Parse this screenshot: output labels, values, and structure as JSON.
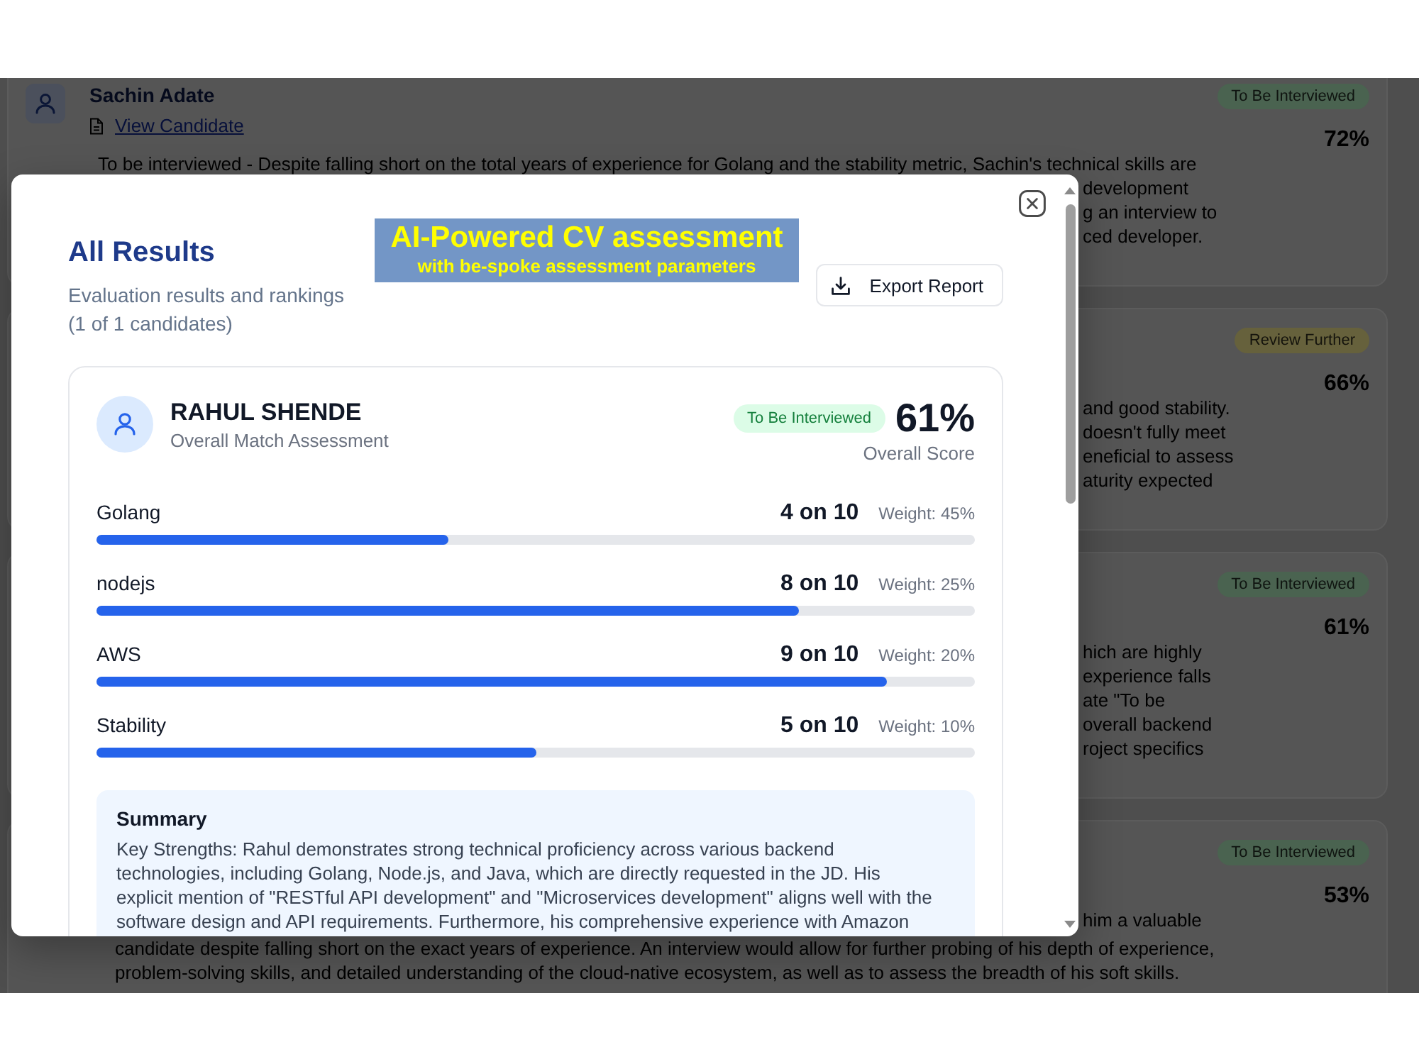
{
  "results_list": {
    "candidates": [
      {
        "name": "Sachin Adate",
        "link": "View Candidate",
        "status": {
          "label": "To Be Interviewed",
          "color": "#4a6350"
        },
        "score": "72%",
        "summary": "To be interviewed - Despite falling short on the total years of experience for Golang and the stability metric, Sachin's technical skills are",
        "fragments": [
          "development",
          "g an interview to",
          "ced developer."
        ]
      },
      {
        "status": {
          "label": "Review Further",
          "color": "#66613c"
        },
        "score": "66%",
        "fragments": [
          "and good stability.",
          "doesn't fully meet",
          "eneficial to assess",
          "aturity expected"
        ]
      },
      {
        "status": {
          "label": "To Be Interviewed",
          "color": "#4a6350"
        },
        "score": "61%",
        "fragments": [
          "hich are highly",
          "experience falls",
          "ate \"To be",
          "overall backend",
          "roject specifics"
        ]
      },
      {
        "status": {
          "label": "To Be Interviewed",
          "color": "#4a6350"
        },
        "score": "53%",
        "fragments": [
          "him a valuable"
        ],
        "tail": [
          "candidate despite falling short on the exact years of experience. An interview would allow for further probing of his depth of experience,",
          "problem-solving skills, and detailed understanding of the cloud-native ecosystem, as well as to assess the breadth of his soft skills."
        ]
      }
    ]
  },
  "modal": {
    "title": "All Results",
    "subtitle": "Evaluation results and rankings",
    "count": "(1 of 1 candidates)",
    "export_button": "Export Report",
    "candidate": {
      "name": "RAHUL SHENDE",
      "caption": "Overall Match Assessment",
      "status": "To Be Interviewed",
      "score": "61%",
      "score_label": "Overall Score",
      "criteria": [
        {
          "name": "Golang",
          "rating": "4 on 10",
          "weight": "Weight: 45%",
          "level": 0.4
        },
        {
          "name": "nodejs",
          "rating": "8 on 10",
          "weight": "Weight: 25%",
          "level": 0.8
        },
        {
          "name": "AWS",
          "rating": "9 on 10",
          "weight": "Weight: 20%",
          "level": 0.9
        },
        {
          "name": "Stability",
          "rating": "5 on 10",
          "weight": "Weight: 10%",
          "level": 0.5
        }
      ],
      "summary": {
        "heading": "Summary",
        "text": "Key Strengths: Rahul demonstrates strong technical proficiency across various backend technologies, including Golang, Node.js, and Java, which are directly requested in the JD. His explicit mention of \"RESTful API development\" and \"Microservices development\" aligns well with the software design and API requirements. Furthermore, his comprehensive experience with Amazon"
      }
    }
  },
  "banner": {
    "title": "AI-Powered CV assessment",
    "subtitle": "with be-spoke assessment parameters"
  }
}
